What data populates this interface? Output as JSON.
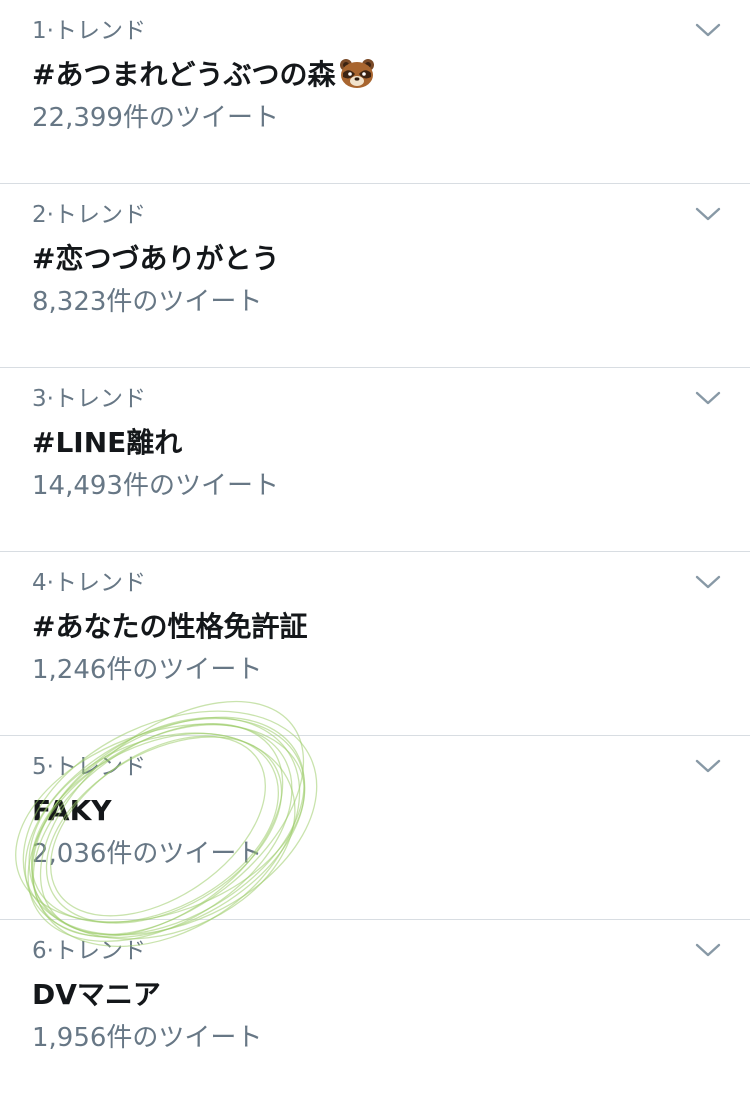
{
  "trends": [
    {
      "meta": "1·トレンド",
      "name": "#あつまれどうぶつの森",
      "icon": "tanuki-face-emoji",
      "count": "22,399件のツイート"
    },
    {
      "meta": "2·トレンド",
      "name": "#恋つづありがとう",
      "count": "8,323件のツイート"
    },
    {
      "meta": "3·トレンド",
      "name": "#LINE離れ",
      "count": "14,493件のツイート"
    },
    {
      "meta": "4·トレンド",
      "name": "#あなたの性格免許証",
      "count": "1,246件のツイート"
    },
    {
      "meta": "5·トレンド",
      "name": "FAKY",
      "count": "2,036件のツイート"
    },
    {
      "meta": "6·トレンド",
      "name": "DVマニア",
      "count": "1,956件のツイート"
    }
  ],
  "colors": {
    "meta_text": "#677785",
    "name_text": "#14171a",
    "divider": "#d8dde2",
    "chevron": "#8899a6",
    "scribble": "#9ccc6a"
  },
  "icons": {
    "chevron": "chevron-down-icon"
  }
}
